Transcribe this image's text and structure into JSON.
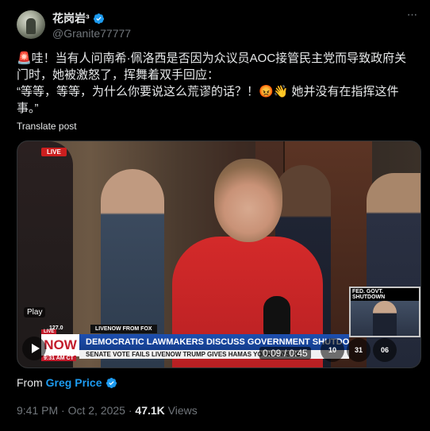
{
  "author": {
    "display_name": "花岗岩³",
    "handle": "@Granite77777",
    "verified": true,
    "verified_color": "#1d9bf0"
  },
  "menu_icon": "more-horizontal-icon",
  "post": {
    "text": "🚨哇！当有人问南希·佩洛西是否因为众议员AOC接管民主党而导致政府关门时，她被激怒了，挥舞着双手回应：\n“等等，等等，为什么你要说这么荒谬的话？！😡👋 她并没有在指挥这件事。”",
    "translate_label": "Translate post"
  },
  "video": {
    "live_badge": "LIVE",
    "play_label": "Play",
    "timecode": "0:09 / 0:45",
    "chyron": "DEMOCRATIC LAWMAKERS DISCUSS GOVERNMENT SHUTDOWN",
    "ticker": "SENATE VOTE FAILS   LIVENOW   TRUMP GIVES HAMAS   YOUR DAYS TO",
    "ticker_left": "127.0",
    "livenow_strip": "LIVENOW FROM FOX",
    "brand": "NOW",
    "brand_live": "LIVE",
    "time_bug": "9:31 AM CT",
    "inset_label": "FED. GOVT. SHUTDOWN",
    "controls": {
      "rewind": "10",
      "forward": "31",
      "skip": "06"
    }
  },
  "from": {
    "prefix": "From",
    "name": "Greg Price"
  },
  "meta": {
    "time": "9:41 PM · Oct 2, 2025 · ",
    "views_count": "47.1K",
    "views_label": " Views"
  }
}
